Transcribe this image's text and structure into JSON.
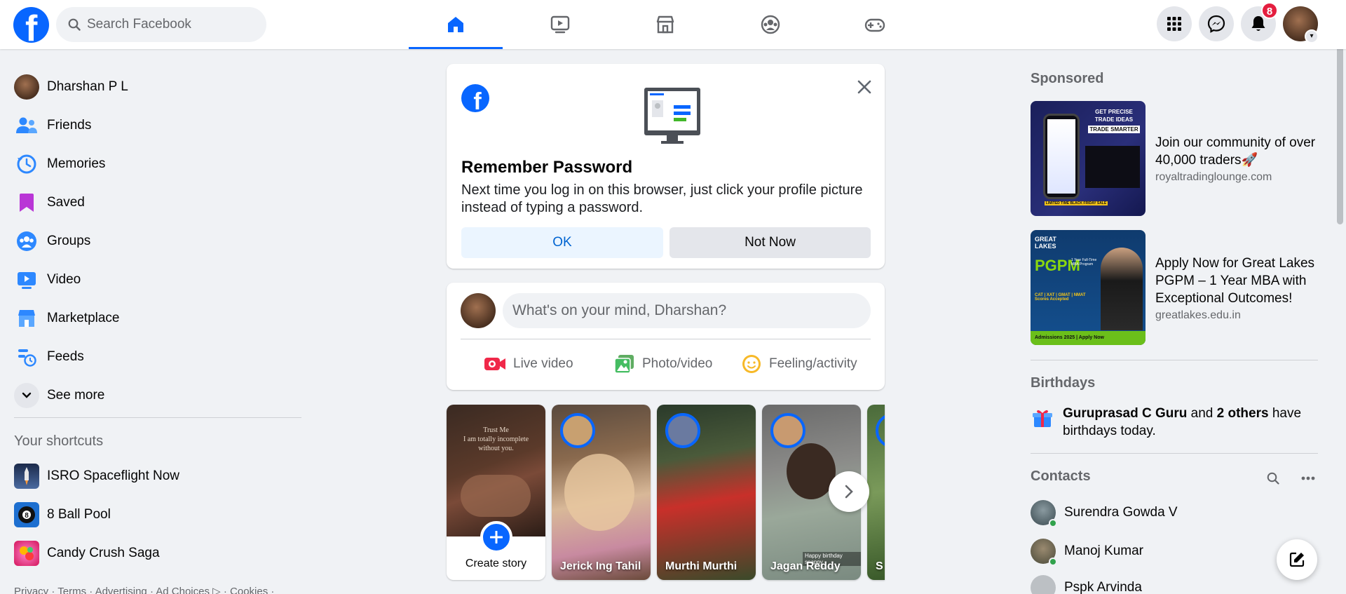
{
  "topbar": {
    "search_placeholder": "Search Facebook",
    "notification_count": "8",
    "tabs": [
      "home-icon",
      "video-icon",
      "marketplace-icon",
      "groups-icon",
      "gaming-icon"
    ]
  },
  "sidebar": {
    "items": [
      {
        "label": "Dharshan P L",
        "icon": "profile-avatar"
      },
      {
        "label": "Friends",
        "icon": "friends-icon"
      },
      {
        "label": "Memories",
        "icon": "memories-icon"
      },
      {
        "label": "Saved",
        "icon": "saved-icon"
      },
      {
        "label": "Groups",
        "icon": "groups-icon"
      },
      {
        "label": "Video",
        "icon": "video-icon"
      },
      {
        "label": "Marketplace",
        "icon": "marketplace-icon"
      },
      {
        "label": "Feeds",
        "icon": "feeds-icon"
      },
      {
        "label": "See more",
        "icon": "chevron-down-icon"
      }
    ],
    "shortcuts_title": "Your shortcuts",
    "shortcuts": [
      {
        "label": "ISRO Spaceflight Now"
      },
      {
        "label": "8 Ball Pool"
      },
      {
        "label": "Candy Crush Saga"
      }
    ],
    "footer": "Privacy · Terms · Advertising · Ad Choices ▷ · Cookies ·"
  },
  "remember_password": {
    "title": "Remember Password",
    "text": "Next time you log in on this browser, just click your profile picture instead of typing a password.",
    "ok_label": "OK",
    "not_now_label": "Not Now"
  },
  "composer": {
    "placeholder": "What's on your mind, Dharshan?",
    "live_label": "Live video",
    "photo_label": "Photo/video",
    "feeling_label": "Feeling/activity"
  },
  "stories": {
    "create_label": "Create story",
    "create_caption": "Trust Me\nI am totally incomplete\nwithout you.",
    "items": [
      {
        "name": "Jerick Ing Tahil"
      },
      {
        "name": "Murthi Murthi"
      },
      {
        "name": "Jagan Reddy",
        "caption": "Happy birthday snappy"
      },
      {
        "name": "S"
      }
    ]
  },
  "right": {
    "sponsored_title": "Sponsored",
    "ads": [
      {
        "text": "Join our community of over 40,000 traders🚀",
        "url": "royaltradinglounge.com",
        "img_lines": [
          "GET PRECISE",
          "TRADE IDEAS",
          "TRADE SMARTER",
          "LIMITED TIME BLACK FRIDAY SALE"
        ]
      },
      {
        "text": "Apply Now for Great Lakes PGPM – 1 Year MBA with Exceptional Outcomes!",
        "url": "greatlakes.edu.in",
        "img_lines": [
          "GREAT LAKES",
          "PGPM",
          "1 Year Full-Time MBA Program",
          "CAT | XAT | GMAT | NMAT Scores Accepted",
          "Admissions 2025 | Apply Now"
        ]
      }
    ],
    "birthdays_title": "Birthdays",
    "birthday_name": "Guruprasad C Guru",
    "birthday_and": " and ",
    "birthday_others": "2 others",
    "birthday_rest": " have birthdays today.",
    "contacts_title": "Contacts",
    "contacts": [
      {
        "name": "Surendra Gowda V"
      },
      {
        "name": "Manoj Kumar"
      },
      {
        "name": "Pspk Arvinda"
      }
    ]
  },
  "colors": {
    "brand_blue": "#0866ff",
    "background": "#f0f2f5",
    "badge_red": "#e41e3f",
    "online_green": "#31a24c"
  }
}
